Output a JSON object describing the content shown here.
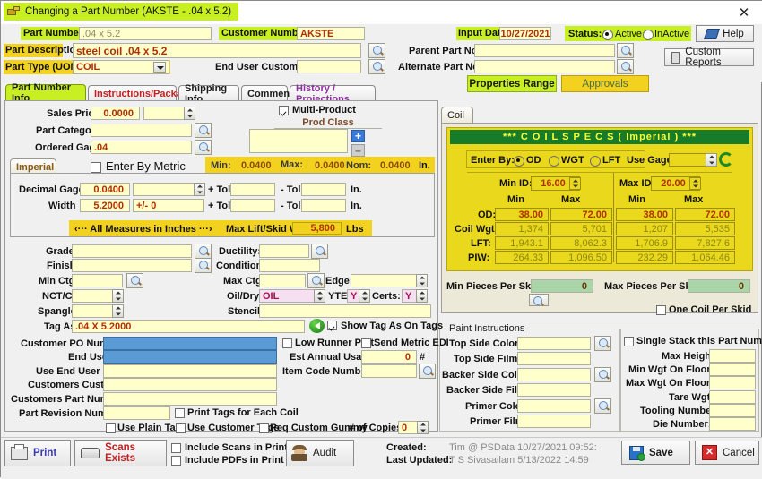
{
  "window": {
    "title": "Changing a Part Number  (AKSTE - .04 x 5.2)",
    "close_label": "✕",
    "icon": "part-window-icon"
  },
  "header": {
    "part_number_label": "Part Number:",
    "part_number_value": ".04 x 5.2",
    "customer_number_label": "Customer Number:",
    "customer_number_value": "AKSTE",
    "input_date_label": "Input Date:",
    "input_date_value": "10/27/2021",
    "status_label": "Status:",
    "status_active": "Active",
    "status_inactive": "InActive",
    "status_selected": "Active",
    "help_label": "Help",
    "custom_reports_label": "Custom Reports",
    "part_description_label": "Part Description",
    "part_description_value": "steel coil .04 x 5.2",
    "parent_part_label": "Parent Part No:",
    "parent_part_value": "",
    "part_type_label": "Part Type (UOM):",
    "part_type_value": "COIL",
    "end_user_customer_label": "End User Customer:",
    "end_user_customer_value": "",
    "alternate_part_label": "Alternate Part No:",
    "alternate_part_value": "",
    "properties_range_label": "Properties Range",
    "approvals_label": "Approvals"
  },
  "tabs": [
    {
      "label": "Part Number Info",
      "selected": true,
      "color": "#000000"
    },
    {
      "label": "Instructions/Packaging",
      "selected": false,
      "color": "#c02020"
    },
    {
      "label": "Shipping Info",
      "selected": false,
      "color": "#000000"
    },
    {
      "label": "Comments",
      "selected": false,
      "color": "#000000"
    },
    {
      "label": "History / Projections",
      "selected": false,
      "color": "#9030a0"
    }
  ],
  "main": {
    "sales_price_label": "Sales Price:",
    "sales_price_value": "0.0000",
    "sales_price_uom": "",
    "part_category_label": "Part Category:",
    "part_category_value": "",
    "ordered_gage_label": "Ordered Gage:",
    "ordered_gage_value": ".04",
    "multi_product_label": "Multi-Product",
    "multi_product_checked": true,
    "prod_class_label": "Prod Class",
    "prod_class_value": "",
    "add_button": "+",
    "remove_button": "–",
    "imperial_tab": "Imperial",
    "enter_by_metric_label": "Enter By Metric",
    "enter_by_metric_checked": false,
    "min_label": "Min:",
    "min_value": "0.0400",
    "max_label": "Max:",
    "max_value": "0.0400",
    "nom_label": "Nom:",
    "nom_value": "0.0400",
    "inch_unit": "In.",
    "decimal_gage_label": "Decimal Gage:",
    "decimal_gage_value": "0.0400",
    "decimal_gage_tol_sel": "",
    "decimal_plus_tol_label": "+ Tol:",
    "decimal_plus_tol_value": "",
    "decimal_minus_tol_label": "- Tol:",
    "decimal_minus_tol_value": "",
    "width_label": "Width",
    "width_value": "5.2000",
    "width_tol_sel": "+/- 0",
    "width_plus_tol_label": "+ Tol:",
    "width_plus_tol_value": "",
    "width_minus_tol_label": "- Tol:",
    "width_minus_tol_value": "",
    "all_measures_label": "‹···  All Measures in Inches  ···›",
    "max_lift_label": "Max Lift/Skid Wgt:",
    "max_lift_value": "5,800",
    "lbs_unit": "Lbs",
    "grade_label": "Grade:",
    "grade_value": "",
    "finish_label": "Finish:",
    "finish_value": "",
    "ductility_label": "Ductility:",
    "ductility_value": "",
    "condition_label": "Condition:",
    "condition_value": "",
    "min_ctg_label": "Min Ctg:",
    "min_ctg_value": "",
    "max_ctg_label": "Max Ctg:",
    "max_ctg_value": "",
    "edge_label": "Edge:",
    "edge_value": "",
    "nct_ct_label": "NCT/CT:",
    "nct_ct_value": "",
    "oil_dry_label": "Oil/Dry:",
    "oil_dry_value": "OIL",
    "yte_label": "YTE:",
    "yte_value": "Y",
    "certs_label": "Certs:",
    "certs_value": "Y",
    "spangle_label": "Spangle:",
    "spangle_value": "",
    "stencil_label": "Stencil:",
    "stencil_value": "",
    "tag_as_label": "Tag As:",
    "tag_as_value": ".04 X  5.2000",
    "show_tag_as_label": "Show Tag As On Tags",
    "show_tag_as_checked": true,
    "customer_po_label": "Customer PO Number:",
    "customer_po_value": "",
    "low_runner_label": "Low Runner Part",
    "low_runner_checked": false,
    "send_metric_edi_label": "Send Metric EDI",
    "send_metric_edi_checked": false,
    "end_use_label": "End Use:",
    "end_use_value": "",
    "est_annual_usage_label": "Est Annual Usage:",
    "est_annual_usage_value": "0",
    "est_annual_usage_unit": "#",
    "use_end_user_po_label": "Use End User PO:",
    "use_end_user_po_value": "",
    "item_code_label": "Item Code Number:",
    "item_code_value": "",
    "customers_cust_po_label": "Customers Cust PO:",
    "customers_cust_po_value": "",
    "customers_part_number_label": "Customers Part Number:",
    "customers_part_number_value": "",
    "part_revision_label": "Part Revision Number:",
    "part_revision_value": "",
    "print_tags_each_coil_label": "Print Tags for Each Coil",
    "print_tags_each_coil_checked": false,
    "use_plain_tags_label": "Use Plain Tags",
    "use_plain_tags_checked": false,
    "use_customer_tags_label": "Use Customer Tags",
    "use_customer_tags_checked": false,
    "req_custom_gummy_label": "Req Custom Gummy",
    "req_custom_gummy_checked": false,
    "copies_label": "# of Copies:",
    "copies_value": "0"
  },
  "coil": {
    "tab_label": "Coil",
    "specs_header": "***   C O I L    S P E C S    ( Imperial )    ***",
    "enter_by_label": "Enter By:",
    "enter_by_options": [
      "OD",
      "WGT",
      "LFT"
    ],
    "enter_by_selected": "OD",
    "use_gage_label": "Use Gage:",
    "use_gage_value": "",
    "refresh_icon": "refresh-icon",
    "min_id_label": "Min ID:",
    "min_id_value": "16.00",
    "max_id_label": "Max ID:",
    "max_id_value": "20.00",
    "col_min": "Min",
    "col_max": "Max",
    "rows": [
      {
        "label": "OD:",
        "left_min": "38.00",
        "left_max": "72.00",
        "right_min": "38.00",
        "right_max": "72.00",
        "red": true
      },
      {
        "label": "Coil Wgt:",
        "left_min": "1,374",
        "left_max": "5,701",
        "right_min": "1,207",
        "right_max": "5,535",
        "red": false
      },
      {
        "label": "LFT:",
        "left_min": "1,943.1",
        "left_max": "8,062.3",
        "right_min": "1,706.9",
        "right_max": "7,827.6",
        "red": false
      },
      {
        "label": "PIW:",
        "left_min": "264.33",
        "left_max": "1,096.50",
        "right_min": "232.29",
        "right_max": "1,064.46",
        "red": false
      }
    ],
    "min_pieces_label": "Min Pieces Per Skid:",
    "min_pieces_value": "0",
    "max_pieces_label": "Max Pieces Per Skid:",
    "max_pieces_value": "0",
    "one_coil_per_skid_label": "One Coil Per Skid",
    "one_coil_per_skid_checked": false
  },
  "paint": {
    "group_label": "Paint Instructions",
    "fields": [
      {
        "label": "Top Side Color:",
        "value": "",
        "search": true
      },
      {
        "label": "Top Side Film:",
        "value": "",
        "search": false
      },
      {
        "label": "Backer Side Color:",
        "value": "",
        "search": true
      },
      {
        "label": "Backer Side Film:",
        "value": "",
        "search": false
      },
      {
        "label": "Primer Color:",
        "value": "",
        "search": true
      },
      {
        "label": "Primer Film:",
        "value": "",
        "search": false
      }
    ]
  },
  "stack": {
    "single_stack_label": "Single Stack this Part Number",
    "single_stack_checked": false,
    "fields": [
      {
        "label": "Max Height:",
        "value": ""
      },
      {
        "label": "Min Wgt On Floor:",
        "value": ""
      },
      {
        "label": "Max Wgt On Floor:",
        "value": ""
      },
      {
        "label": "Tare Wgt:",
        "value": ""
      },
      {
        "label": "Tooling Number:",
        "value": ""
      },
      {
        "label": "Die Number:",
        "value": ""
      }
    ]
  },
  "footer": {
    "print_label": "Print",
    "scans_exists_label": "Scans Exists",
    "include_scans_label": "Include Scans in Print",
    "include_scans_checked": false,
    "include_pdfs_label": "Include PDFs in Print",
    "include_pdfs_checked": false,
    "audit_label": "Audit",
    "created_label": "Created:",
    "created_value": "Tim @ PSData 10/27/2021 09:52:",
    "last_updated_label": "Last Updated:",
    "last_updated_value": "T S Sivasailam 5/13/2022 14:59",
    "save_label": "Save",
    "cancel_label": "Cancel"
  },
  "colors": {
    "accent_green": "#c8ef22",
    "accent_yellow": "#f2d21e",
    "field_yellow": "#ffffcc",
    "coil_yellow": "#ead81c",
    "header_green": "#177c2a",
    "blue_field": "#5b9bd5"
  }
}
